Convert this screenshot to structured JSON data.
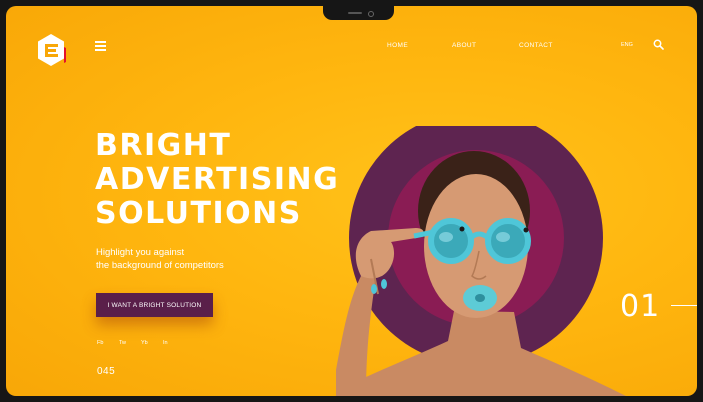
{
  "nav": {
    "links": [
      "HOME",
      "ABOUT",
      "CONTACT"
    ],
    "language": "ENG"
  },
  "hero": {
    "headline": [
      "BRIGHT",
      "ADVERTISING",
      "SOLUTIONS"
    ],
    "subtitle_lines": [
      "Highlight you against",
      "the background of competitors"
    ],
    "cta_label": "I WANT A BRIGHT SOLUTION"
  },
  "social": [
    "Fb",
    "Tw",
    "Yb",
    "In"
  ],
  "counter": "045",
  "slide_number": "01",
  "colors": {
    "background": "#ffb60f",
    "accent": "#5a1f4a",
    "circle": "#5e2450",
    "logo_red": "#e3122c",
    "lens": "#4fc6d8",
    "lips": "#5dcbd6"
  },
  "icons": [
    "logo-icon",
    "menu-icon",
    "search-icon"
  ]
}
